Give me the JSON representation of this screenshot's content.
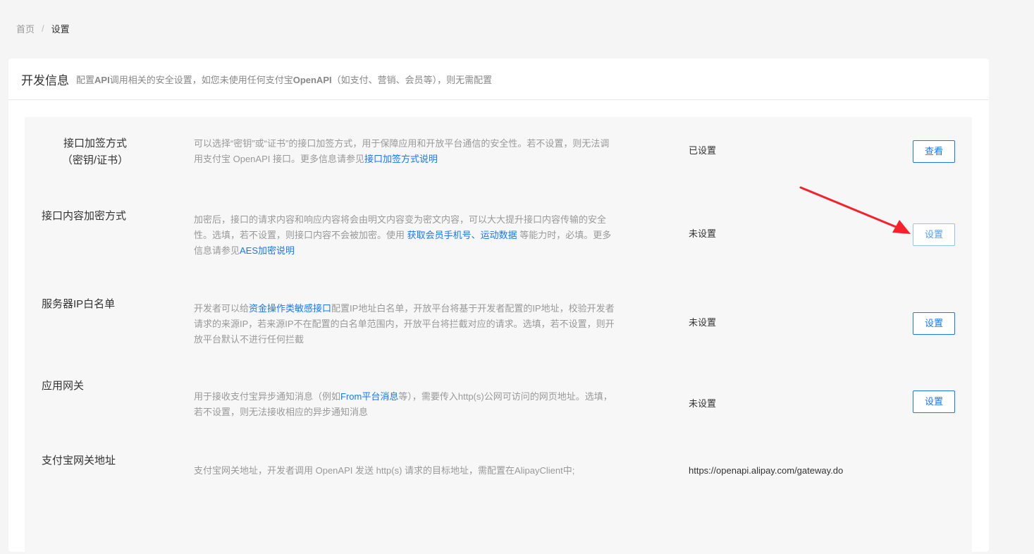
{
  "breadcrumb": {
    "home": "首页",
    "separator": "/",
    "current": "设置"
  },
  "header": {
    "title": "开发信息",
    "desc_prefix": "配置",
    "desc_api": "API",
    "desc_mid": "调用相关的安全设置，如您未使用任何支付宝",
    "desc_openapi": "OpenAPI",
    "desc_suffix": "（如支付、营销、会员等），则无需配置"
  },
  "rows": [
    {
      "label_line1": "接口加签方式",
      "label_line2": "（密钥/证书）",
      "desc_line1": "可以选择“密钥”或“证书”的接口加签方式，用于保障应用和开放平台通信的安全性。若不设置，则无法调",
      "desc_line2_prefix": "用支付宝 OpenAPI 接口。更多信息请参见",
      "desc_line2_link": "接口加签方式说明",
      "status": "已设置",
      "button": "查看"
    },
    {
      "label": "接口内容加密方式",
      "desc_line1": "加密后，接口的请求内容和响应内容将会由明文内容变为密文内容，可以大大提升接口内容传输的安全",
      "desc_line2_prefix": "性。选填，若不设置，则接口内容不会被加密。使用 ",
      "desc_line2_link1": "获取会员手机号",
      "desc_line2_sep": "、",
      "desc_line2_link2": "运动数据",
      "desc_line2_suffix": " 等能力时，必填。更多",
      "desc_line3_prefix": "信息请参见",
      "desc_line3_link": "AES加密说明",
      "status": "未设置",
      "button": "设置"
    },
    {
      "label": "服务器IP白名单",
      "desc_line1_prefix": "开发者可以给",
      "desc_line1_link": "资金操作类敏感接口",
      "desc_line1_suffix": "配置IP地址白名单，开放平台将基于开发者配置的IP地址，校验开发者",
      "desc_line2": "请求的来源IP，若来源IP不在配置的白名单范围内，开放平台将拦截对应的请求。选填，若不设置，则开",
      "desc_line3": "放平台默认不进行任何拦截",
      "status": "未设置",
      "button": "设置"
    },
    {
      "label": "应用网关",
      "desc_line1_prefix": "用于接收支付宝异步通知消息（例如",
      "desc_line1_link": "From平台消息",
      "desc_line1_suffix": "等），需要传入http(s)公网可访问的网页地址。选填，",
      "desc_line2": "若不设置，则无法接收相应的异步通知消息",
      "status": "未设置",
      "button": "设置"
    },
    {
      "label": "支付宝网关地址",
      "desc": "支付宝网关地址，开发者调用 OpenAPI 发送 http(s) 请求的目标地址，需配置在AlipayClient中;",
      "status": "https://openapi.alipay.com/gateway.do"
    }
  ],
  "colors": {
    "accent": "#1677ff",
    "arrow": "#f5222d"
  },
  "icons": {
    "annotation": "red-arrow-icon"
  }
}
